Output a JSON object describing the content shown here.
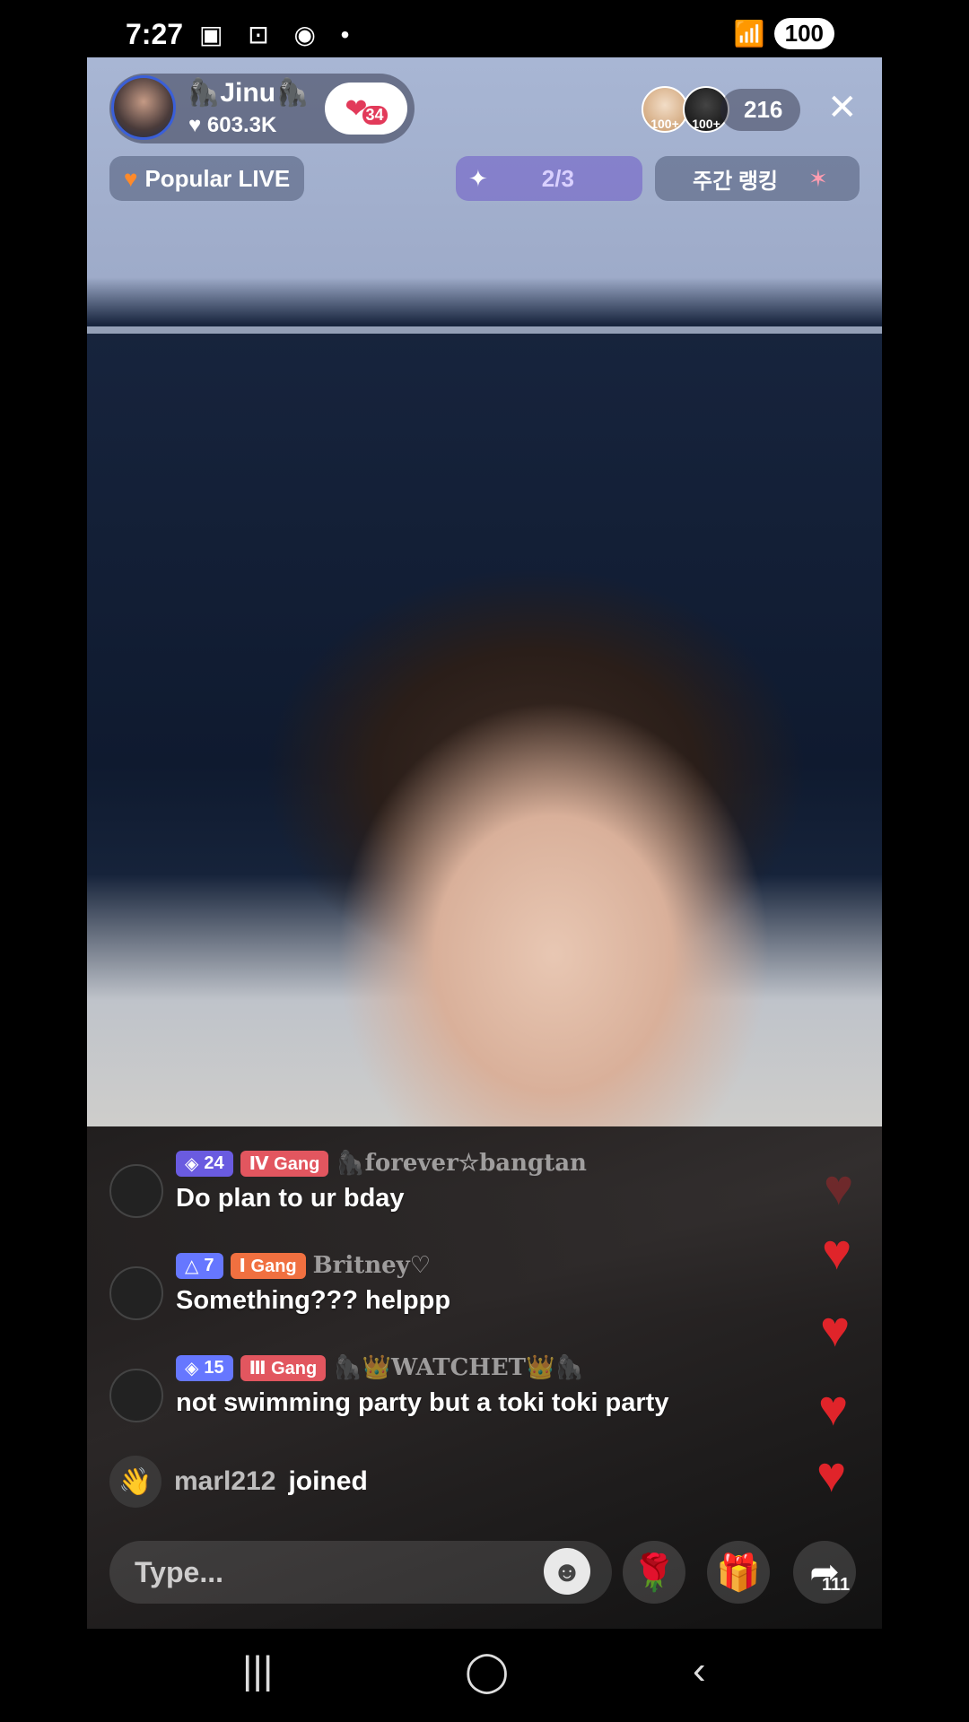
{
  "status_bar": {
    "time": "7:27",
    "left_icons": "▣ ⊡ ◉ •",
    "signal": "📶",
    "battery": "100"
  },
  "header": {
    "streamer_name": "🦍Jinu🦍",
    "likes": "♥ 603.3K",
    "fan_badge_icon": "❤",
    "fan_badge_count": "34",
    "viewer_badges": [
      "100+",
      "100+"
    ],
    "viewer_count": "216",
    "close_icon": "✕"
  },
  "sub_header": {
    "popular_label": "Popular LIVE",
    "mission_progress": "2/3",
    "weekly_ranking_label": "주간 랭킹"
  },
  "chat": [
    {
      "level": "24",
      "gang": "Ⅳ Gang",
      "username": "🦍forever☆bangtan",
      "message": "Do plan to ur bday"
    },
    {
      "level": "7",
      "gang": "Ⅰ Gang",
      "username": "Britney♡",
      "message": "Something??? helppp"
    },
    {
      "level": "15",
      "gang": "Ⅲ Gang",
      "username": "🦍👑WATCHET👑🦍",
      "message": "not swimming party but a toki toki party"
    }
  ],
  "joined": {
    "user": "marl212",
    "action": "joined"
  },
  "compose": {
    "placeholder": "Type..."
  },
  "actions": {
    "share_count": "111"
  },
  "colors": {
    "accent_purple": "#6a5be0",
    "gang_red": "#e2565f",
    "heart_red": "#e0242a"
  }
}
